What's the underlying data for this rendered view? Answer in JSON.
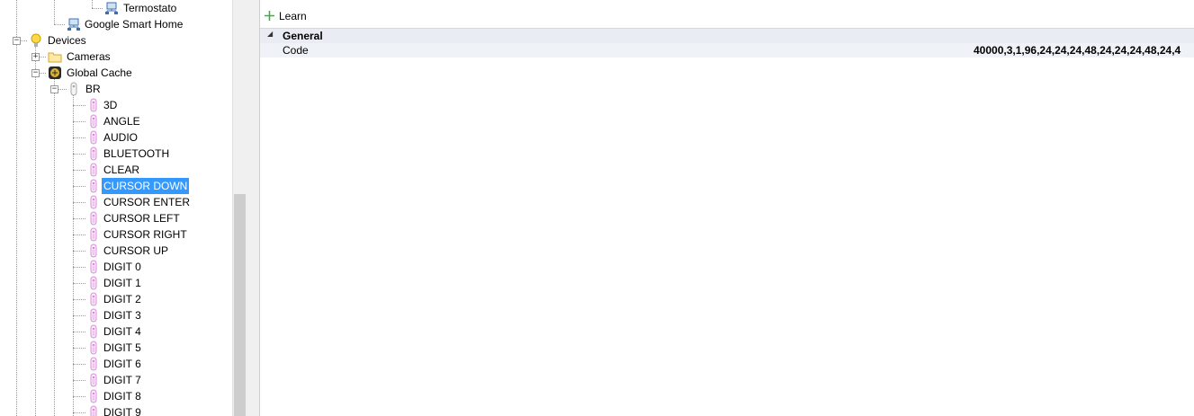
{
  "tree": {
    "termostato": "Termostato",
    "google_smart_home": "Google Smart Home",
    "devices": "Devices",
    "cameras": "Cameras",
    "global_cache": "Global Cache",
    "br": "BR",
    "commands": [
      "3D",
      "ANGLE",
      "AUDIO",
      "BLUETOOTH",
      "CLEAR",
      "CURSOR DOWN",
      "CURSOR ENTER",
      "CURSOR LEFT",
      "CURSOR RIGHT",
      "CURSOR UP",
      "DIGIT 0",
      "DIGIT 1",
      "DIGIT 2",
      "DIGIT 3",
      "DIGIT 4",
      "DIGIT 5",
      "DIGIT 6",
      "DIGIT 7",
      "DIGIT 8",
      "DIGIT 9"
    ],
    "selected_command": "CURSOR DOWN"
  },
  "toolbar": {
    "learn_label": "Learn"
  },
  "properties": {
    "category": "General",
    "rows": [
      {
        "name": "Code",
        "value": "40000,3,1,96,24,24,24,48,24,24,24,48,24,4"
      }
    ]
  },
  "colors": {
    "selection": "#3399ff",
    "grid_category": "#e9edf3",
    "remote_icon": "#d98cd9"
  }
}
